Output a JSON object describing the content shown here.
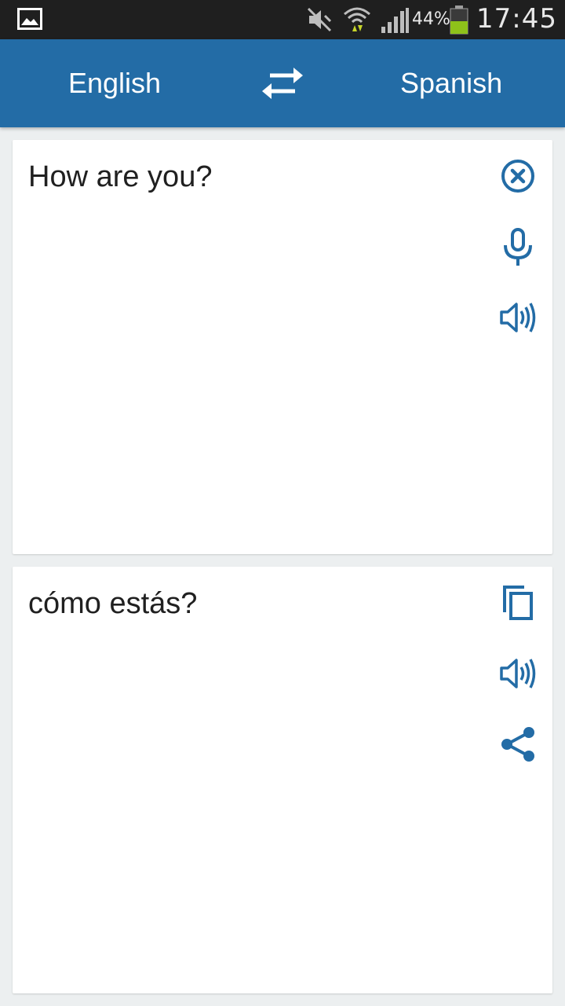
{
  "status_bar": {
    "battery_percent": "44%",
    "time": "17:45",
    "icons": [
      "image-icon",
      "mute-icon",
      "wifi-icon",
      "signal-icon",
      "battery-icon"
    ]
  },
  "header": {
    "source_language": "English",
    "target_language": "Spanish",
    "swap_icon": "swap-arrows-icon"
  },
  "source_panel": {
    "text": "How are you?",
    "icons": [
      "clear-icon",
      "microphone-icon",
      "speaker-icon"
    ]
  },
  "target_panel": {
    "text": "cómo estás?",
    "icons": [
      "copy-icon",
      "speaker-icon",
      "share-icon"
    ]
  },
  "colors": {
    "app_bar": "#236ca6",
    "icon": "#236ca6",
    "status_bar": "#1f1f1f",
    "background": "#eceff0"
  }
}
